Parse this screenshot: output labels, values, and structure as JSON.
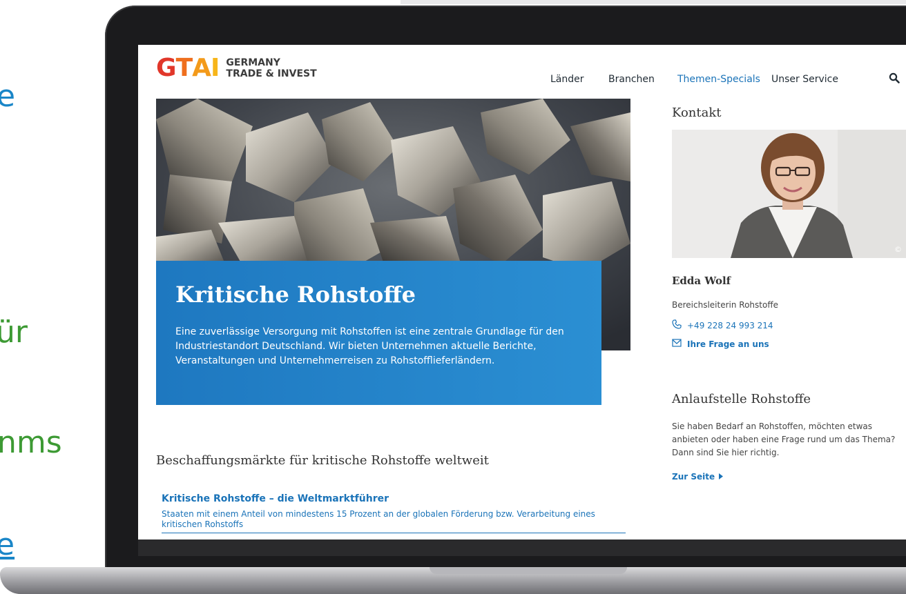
{
  "slide": {
    "fragments": [
      "e",
      "ür",
      "nms",
      "e"
    ]
  },
  "site": {
    "logo": {
      "mark": "GTAI",
      "line1": "GERMANY",
      "line2": "TRADE & INVEST"
    },
    "nav": [
      "Länder",
      "Branchen",
      "Themen-Specials",
      "Unser Service"
    ],
    "active_nav": "Themen-Specials"
  },
  "hero": {
    "title": "Kritische Rohstoffe",
    "text": "Eine zuverlässige Versorgung mit Rohstoffen ist eine zentrale Grundlage für den Industriestandort Deutschland. Wir bieten Unternehmen aktuelle Berichte, Veranstaltungen und Unternehmerreisen zu Rohstofflieferländern."
  },
  "markets": {
    "heading": "Beschaffungsmärkte für kritische Rohstoffe weltweit",
    "item_title": "Kritische Rohstoffe – die Weltmarktführer",
    "item_desc": "Staaten mit einem Anteil von mindestens 15 Prozent an der globalen Förderung bzw. Verarbeitung eines kritischen Rohstoffs"
  },
  "contact": {
    "heading": "Kontakt",
    "name": "Edda Wolf",
    "role": "Bereichsleiterin Rohstoffe",
    "phone": "+49 228 24 993 214",
    "ask": "Ihre Frage an uns",
    "copyright_mark": "©"
  },
  "anlauf": {
    "heading": "Anlaufstelle Rohstoffe",
    "text": "Sie haben Bedarf an Rohstoffen, möchten etwas anbieten oder haben eine Frage rund um das Thema? Dann sind Sie hier richtig.",
    "link": "Zur Seite"
  },
  "colors": {
    "accent": "#1a73b8",
    "hero_blue": "#2285cb",
    "slide_green": "#3d9a34"
  }
}
